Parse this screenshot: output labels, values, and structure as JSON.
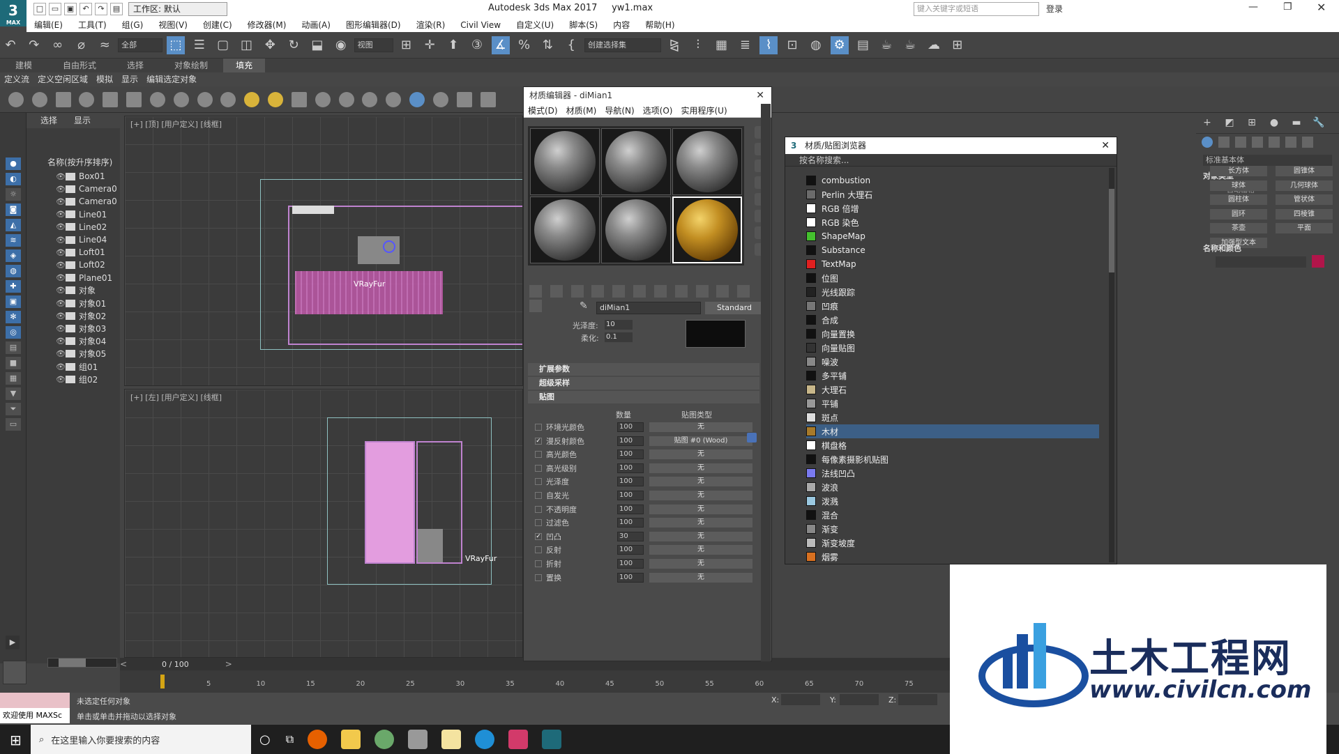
{
  "app": {
    "logo_text": "3",
    "logo_sub": "MAX",
    "workspace": "工作区: 默认",
    "title": "Autodesk 3ds Max 2017",
    "file": "yw1.max",
    "help_search_placeholder": "键入关键字或短语",
    "login": "登录"
  },
  "menu": [
    "编辑(E)",
    "工具(T)",
    "组(G)",
    "视图(V)",
    "创建(C)",
    "修改器(M)",
    "动画(A)",
    "图形编辑器(D)",
    "渲染(R)",
    "Civil View",
    "自定义(U)",
    "脚本(S)",
    "内容",
    "帮助(H)"
  ],
  "toolbar": {
    "filter": "全部",
    "view": "视图",
    "selection_set": "创建选择集"
  },
  "ribbon": {
    "tabs": [
      "建模",
      "自由形式",
      "选择",
      "对象绘制",
      "填充"
    ],
    "active": "填充",
    "sub": [
      "定义流",
      "定义空闲区域",
      "模拟",
      "显示",
      "编辑选定对象"
    ]
  },
  "explorer": {
    "tabs": [
      "选择",
      "显示"
    ],
    "header": "名称(按升序排序)",
    "items": [
      "Box01",
      "Camera0",
      "Camera0",
      "Line01",
      "Line02",
      "Line04",
      "Loft01",
      "Loft02",
      "Plane01",
      "对象",
      "对象01",
      "对象02",
      "对象03",
      "对象04",
      "对象05",
      "组01",
      "组02"
    ]
  },
  "viewports": {
    "top_label": "[+] [顶] [用户定义] [线框]",
    "left_label": "[+] [左] [用户定义] [线框]",
    "fur_label": "VRayFur",
    "fur_label2": "VRayFur"
  },
  "material_editor": {
    "title": "材质编辑器 - diMian1",
    "menu": [
      "模式(D)",
      "材质(M)",
      "导航(N)",
      "选项(O)",
      "实用程序(U)"
    ],
    "material_name": "diMian1",
    "material_type": "Standard",
    "glossiness_label": "光泽度:",
    "glossiness_value": "10",
    "soften_label": "柔化:",
    "soften_value": "0.1",
    "rollouts": [
      "扩展参数",
      "超级采样",
      "贴图"
    ],
    "map_headers": {
      "amount": "数量",
      "type": "贴图类型"
    },
    "maps": [
      {
        "label": "环境光颜色",
        "checked": false,
        "amount": "100",
        "map": "无"
      },
      {
        "label": "漫反射颜色",
        "checked": true,
        "amount": "100",
        "map": "贴图 #0 (Wood)"
      },
      {
        "label": "高光颜色",
        "checked": false,
        "amount": "100",
        "map": "无"
      },
      {
        "label": "高光级别",
        "checked": false,
        "amount": "100",
        "map": "无"
      },
      {
        "label": "光泽度",
        "checked": false,
        "amount": "100",
        "map": "无"
      },
      {
        "label": "自发光",
        "checked": false,
        "amount": "100",
        "map": "无"
      },
      {
        "label": "不透明度",
        "checked": false,
        "amount": "100",
        "map": "无"
      },
      {
        "label": "过滤色",
        "checked": false,
        "amount": "100",
        "map": "无"
      },
      {
        "label": "凹凸",
        "checked": true,
        "amount": "30",
        "map": "无"
      },
      {
        "label": "反射",
        "checked": false,
        "amount": "100",
        "map": "无"
      },
      {
        "label": "折射",
        "checked": false,
        "amount": "100",
        "map": "无"
      },
      {
        "label": "置换",
        "checked": false,
        "amount": "100",
        "map": "无"
      }
    ]
  },
  "browser": {
    "title": "材质/贴图浏览器",
    "search_placeholder": "按名称搜索...",
    "items": [
      {
        "name": "combustion",
        "color": "#111111"
      },
      {
        "name": "Perlin 大理石",
        "color": "#6b6b6b"
      },
      {
        "name": "RGB 倍增",
        "color": "#ffffff"
      },
      {
        "name": "RGB 染色",
        "color": "#ffffff"
      },
      {
        "name": "ShapeMap",
        "color": "#44c02e"
      },
      {
        "name": "Substance",
        "color": "#111111"
      },
      {
        "name": "TextMap",
        "color": "#e02020"
      },
      {
        "name": "位图",
        "color": "#111111"
      },
      {
        "name": "光线跟踪",
        "color": "#222222"
      },
      {
        "name": "凹痕",
        "color": "#777777"
      },
      {
        "name": "合成",
        "color": "#111111"
      },
      {
        "name": "向量置换",
        "color": "#111111"
      },
      {
        "name": "向量贴图",
        "color": "#333333"
      },
      {
        "name": "噪波",
        "color": "#888888"
      },
      {
        "name": "多平铺",
        "color": "#111111"
      },
      {
        "name": "大理石",
        "color": "#c8b78a"
      },
      {
        "name": "平铺",
        "color": "#999999"
      },
      {
        "name": "斑点",
        "color": "#dddddd"
      },
      {
        "name": "木材",
        "color": "#a77a2a"
      },
      {
        "name": "棋盘格",
        "color": "#ffffff"
      },
      {
        "name": "每像素摄影机贴图",
        "color": "#111111"
      },
      {
        "name": "法线凹凸",
        "color": "#7a7af0"
      },
      {
        "name": "波浪",
        "color": "#aaaaaa"
      },
      {
        "name": "泼溅",
        "color": "#9ac8e0"
      },
      {
        "name": "混合",
        "color": "#111111"
      },
      {
        "name": "渐变",
        "color": "#888888"
      },
      {
        "name": "渐变坡度",
        "color": "#bbbbbb"
      },
      {
        "name": "烟雾",
        "color": "#d87020"
      }
    ],
    "selected": "木材"
  },
  "command_panel": {
    "dropdown": "标准基本体",
    "object_type": "对象类型",
    "autogrid": "自动栅格",
    "buttons": [
      "长方体",
      "圆锥体",
      "球体",
      "几何球体",
      "圆柱体",
      "管状体",
      "圆环",
      "四棱锥",
      "茶壶",
      "平面",
      "加强型文本"
    ],
    "name_color": "名称和颜色"
  },
  "timeline": {
    "frame": "0 / 100",
    "ticks": [
      "5",
      "10",
      "15",
      "20",
      "25",
      "30",
      "35",
      "40",
      "45",
      "50",
      "55",
      "60",
      "65",
      "70",
      "75"
    ]
  },
  "status": {
    "welcome": "欢迎使用 MAXSc",
    "line1": "未选定任何对象",
    "line2": "单击或单击并拖动以选择对象",
    "x_label": "X:",
    "y_label": "Y:",
    "z_label": "Z:"
  },
  "taskbar": {
    "search_placeholder": "在这里输入你要搜索的内容"
  },
  "watermark": {
    "cn": "土木工程网",
    "url": "www.civilcn.com"
  }
}
